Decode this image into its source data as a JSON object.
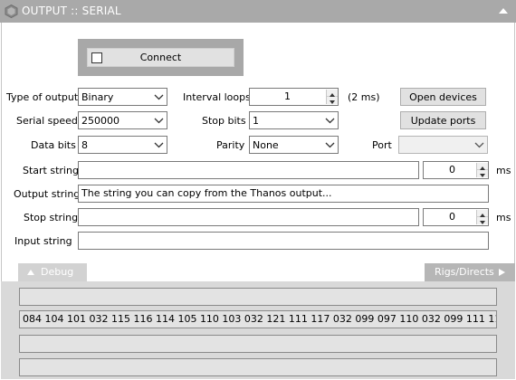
{
  "window": {
    "title": "OUTPUT :: SERIAL"
  },
  "connect": {
    "label": "Connect",
    "checked": false
  },
  "left": {
    "type_label": "Type of output",
    "type_value": "Binary",
    "speed_label": "Serial speed",
    "speed_value": "250000",
    "databits_label": "Data bits",
    "databits_value": "8"
  },
  "mid": {
    "interval_label": "Interval loops",
    "interval_value": "1",
    "interval_note": "(2 ms)",
    "stopbits_label": "Stop bits",
    "stopbits_value": "1",
    "parity_label": "Parity",
    "parity_value": "None",
    "port_label": "Port",
    "port_value": ""
  },
  "buttons": {
    "open_devices": "Open devices",
    "update_ports": "Update ports"
  },
  "strings": {
    "start_label": "Start string",
    "start_value": "",
    "start_ms": "0",
    "ms_unit": "ms",
    "output_label": "Output string",
    "output_value": "The string you can copy from the Thanos output...",
    "stop_label": "Stop string",
    "stop_value": "",
    "stop_ms": "0",
    "input_label": "Input string",
    "input_value": ""
  },
  "tabs": {
    "debug": "Debug",
    "rigs": "Rigs/Directs"
  },
  "debug": {
    "line1": "",
    "line2": "084 104 101 032 115 116 114 105 110 103 032 121 111 117 032 099 097 110 032 099 111 112 121 032 1...",
    "line3": "",
    "line4": ""
  }
}
